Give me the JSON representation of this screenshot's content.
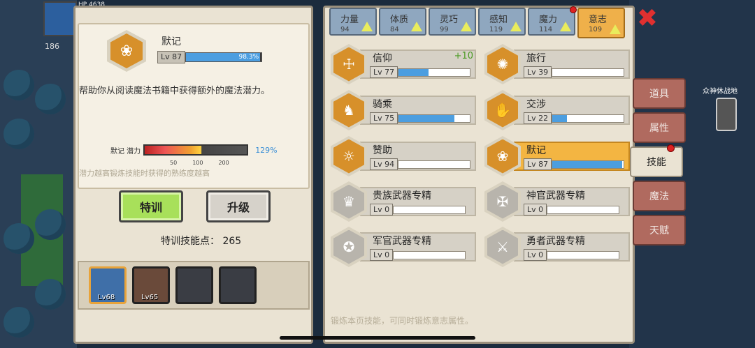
{
  "hud": {
    "hp_label": "HP 4638",
    "level_badge": "186"
  },
  "detail": {
    "skill_name": "默记",
    "level": "Lv 87",
    "progress_pct": 98.3,
    "progress_text": "98.3%",
    "description": "帮助你从阅读魔法书籍中获得额外的魔法潜力。",
    "potential_label": "默记 潜力",
    "potential_pct_text": "129%",
    "potential_ticks": [
      "50",
      "100",
      "200"
    ],
    "hint": "潜力越高锻炼技能时获得的熟练度越高",
    "train_label": "特训",
    "upgrade_label": "升级",
    "points_text": "特训技能点： 265"
  },
  "party": [
    {
      "level": "Lv68",
      "active": true
    },
    {
      "level": "Lv65",
      "active": false
    },
    {
      "level": "",
      "active": false
    },
    {
      "level": "",
      "active": false
    }
  ],
  "tabs": [
    {
      "label": "力量",
      "value": "94"
    },
    {
      "label": "体质",
      "value": "84"
    },
    {
      "label": "灵巧",
      "value": "99"
    },
    {
      "label": "感知",
      "value": "119"
    },
    {
      "label": "魔力",
      "value": "114"
    },
    {
      "label": "意志",
      "value": "109"
    }
  ],
  "skills": [
    {
      "name": "信仰",
      "level": "Lv 77",
      "progress": 0.42,
      "bonus": "+10",
      "icon": "☩"
    },
    {
      "name": "旅行",
      "level": "Lv 39",
      "progress": 0.0,
      "bonus": "",
      "icon": "✺"
    },
    {
      "name": "骑乘",
      "level": "Lv 75",
      "progress": 0.78,
      "bonus": "",
      "icon": "♞"
    },
    {
      "name": "交涉",
      "level": "Lv 22",
      "progress": 0.2,
      "bonus": "",
      "icon": "✋"
    },
    {
      "name": "赞助",
      "level": "Lv 94",
      "progress": 0.0,
      "bonus": "",
      "icon": "☼"
    },
    {
      "name": "默记",
      "level": "Lv 87",
      "progress": 0.98,
      "bonus": "",
      "icon": "❀"
    },
    {
      "name": "贵族武器专精",
      "level": "Lv 0",
      "progress": 0.0,
      "bonus": "",
      "icon": "♛"
    },
    {
      "name": "神官武器专精",
      "level": "Lv 0",
      "progress": 0.0,
      "bonus": "",
      "icon": "✠"
    },
    {
      "name": "军官武器专精",
      "level": "Lv 0",
      "progress": 0.0,
      "bonus": "",
      "icon": "✪"
    },
    {
      "name": "勇者武器专精",
      "level": "Lv 0",
      "progress": 0.0,
      "bonus": "",
      "icon": "⚔"
    }
  ],
  "footer_hint": "锻炼本页技能，可同时锻炼意志属性。",
  "close_label": "✖",
  "side_menu": [
    "道具",
    "属性",
    "技能",
    "魔法",
    "天赋"
  ],
  "map_label": "众神休战地"
}
